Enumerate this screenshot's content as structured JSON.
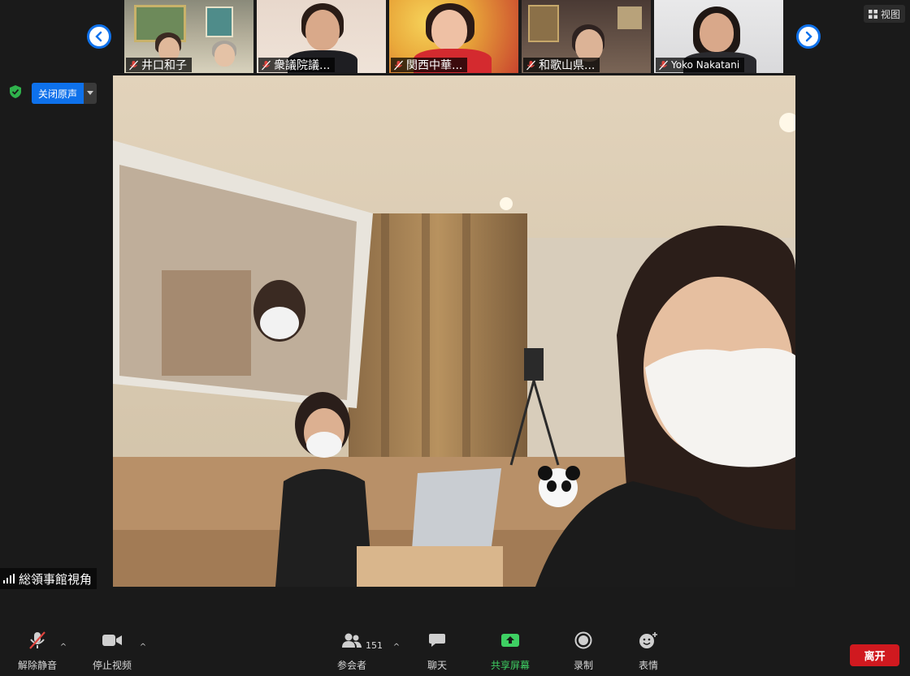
{
  "top_bar": {
    "view_label": "视图",
    "participants_strip": [
      {
        "name": "井口和子",
        "muted": true
      },
      {
        "name": "衆議院議...",
        "muted": true
      },
      {
        "name": "関西中華...",
        "muted": true
      },
      {
        "name": "和歌山県...",
        "muted": true
      },
      {
        "name": "Yoko Nakatani",
        "muted": true
      }
    ]
  },
  "original_sound": {
    "label": "关闭原声"
  },
  "main_video": {
    "speaker_name": "総領事館視角"
  },
  "toolbar": {
    "unmute_label": "解除静音",
    "stop_video_label": "停止视频",
    "participants_label": "参会者",
    "participants_count": "151",
    "chat_label": "聊天",
    "share_label": "共享屏幕",
    "record_label": "录制",
    "reactions_label": "表情",
    "leave_label": "离开"
  },
  "colors": {
    "accent": "#0e71eb",
    "share_green": "#3ed063",
    "leave_red": "#d0191f",
    "security_green": "#2fb24c"
  }
}
